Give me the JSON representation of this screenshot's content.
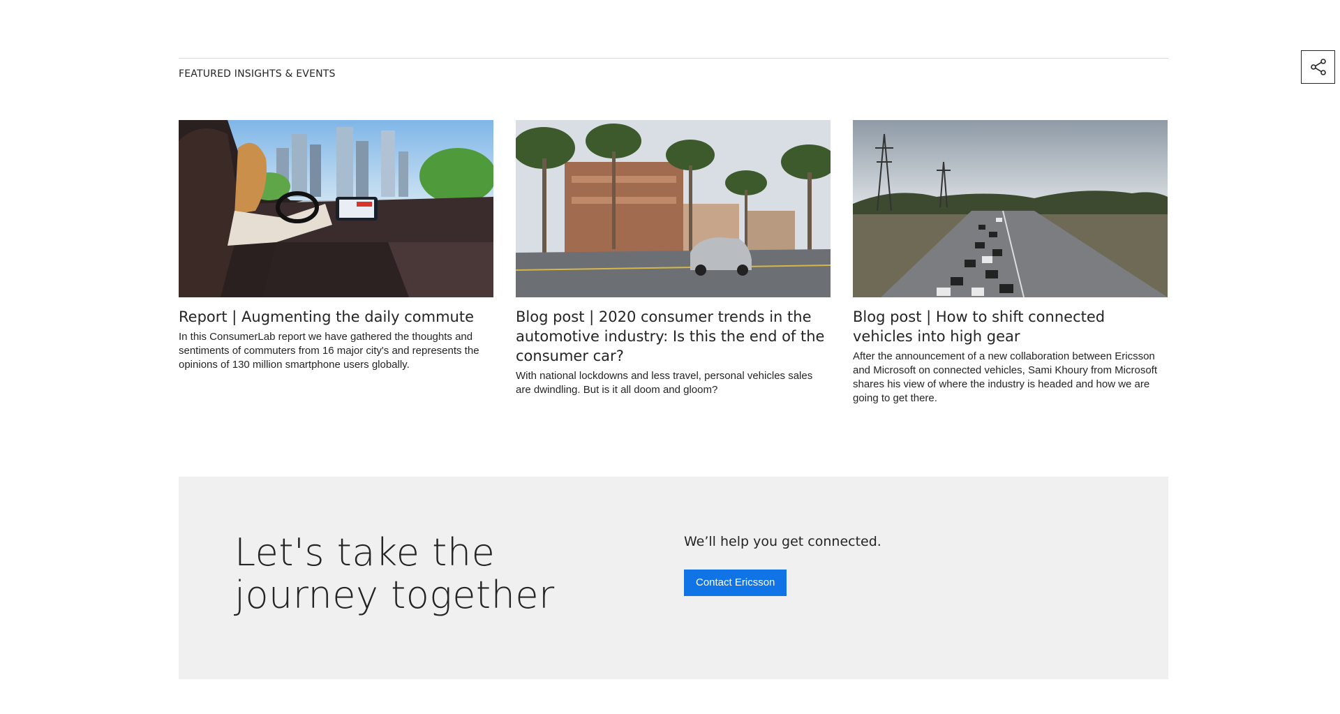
{
  "share": {
    "icon": "share-icon"
  },
  "featured": {
    "label": "FEATURED INSIGHTS & EVENTS",
    "cards": [
      {
        "title": "Report | Augmenting the daily commute",
        "description": "In this ConsumerLab report we have gathered the thoughts and sentiments of commuters from 16 major city's and represents the opinions of 130 million smartphone users globally."
      },
      {
        "title": "Blog post | 2020 consumer trends in the automotive industry: Is this the end of the consumer car?",
        "description": "With national lockdowns and less travel, personal vehicles sales are dwindling. But is it all doom and gloom?"
      },
      {
        "title": "Blog post | How to shift connected vehicles into high gear",
        "description": "After the announcement of a new collaboration between Ericsson and Microsoft on connected vehicles, Sami Khoury from Microsoft shares his view of where the industry is headed and how we are going to get there."
      }
    ]
  },
  "cta": {
    "heading": "Let's take the journey together",
    "subtitle": "We’ll help you get connected.",
    "button_label": "Contact Ericsson"
  },
  "colors": {
    "accent": "#1174e6",
    "cta_background": "#f0f0f0",
    "text": "#242424"
  }
}
